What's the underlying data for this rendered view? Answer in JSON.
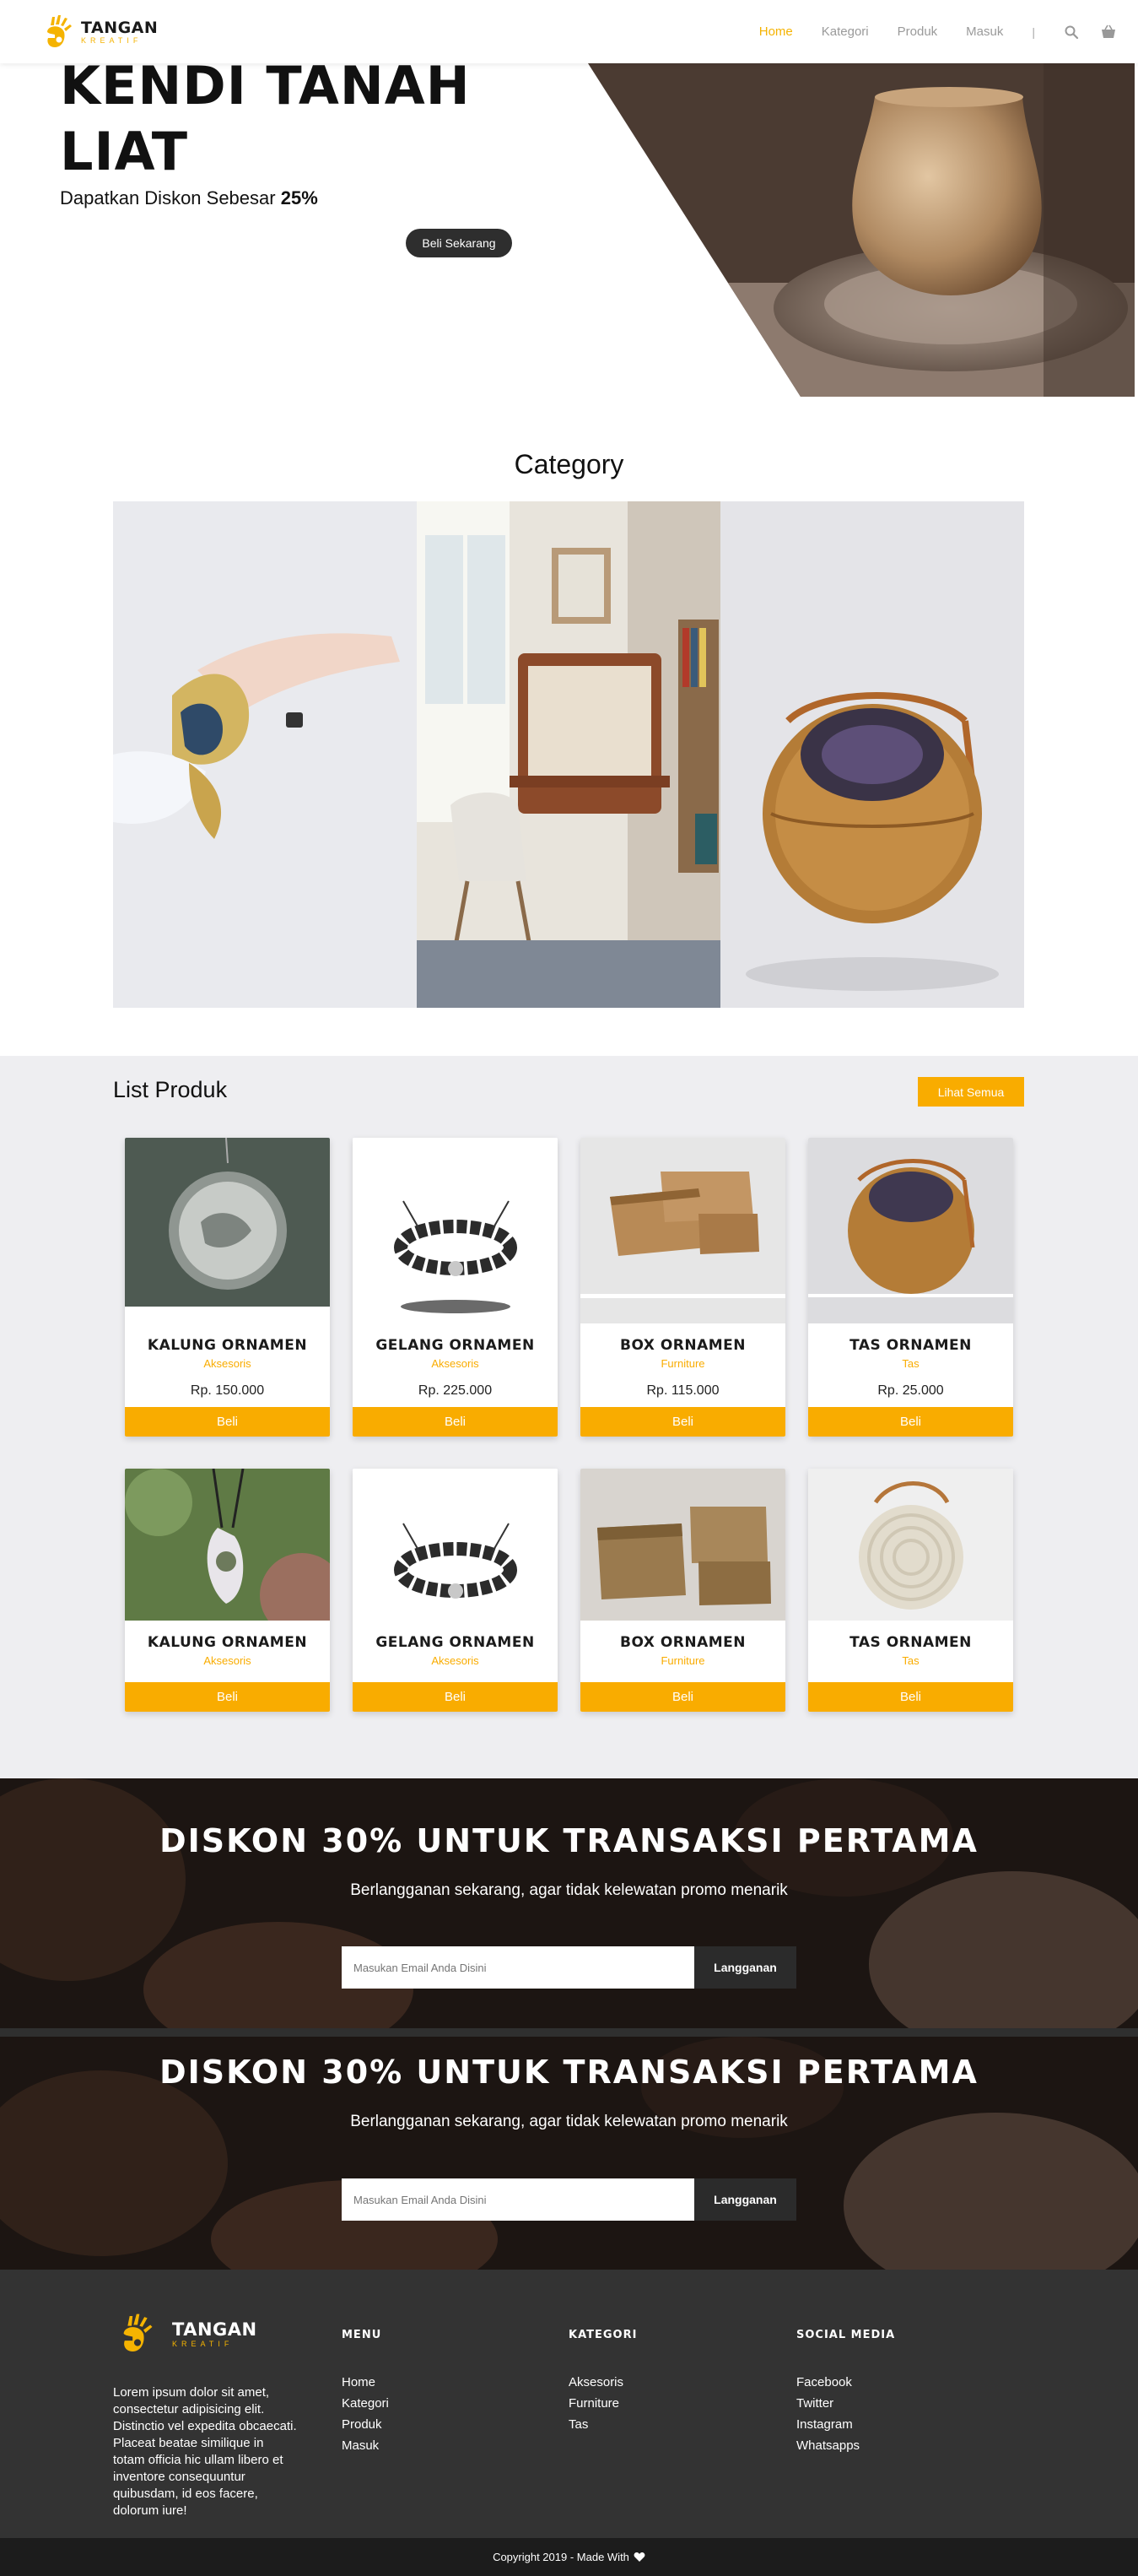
{
  "brand": {
    "name": "TANGAN",
    "tagline": "KREATIF"
  },
  "nav": {
    "items": [
      "Home",
      "Kategori",
      "Produk",
      "Masuk"
    ],
    "separator": "|",
    "icons": [
      "search-icon",
      "basket-icon"
    ]
  },
  "hero": {
    "title_line1": "KENDI TANAH",
    "title_line2": "LIAT",
    "subtitle_prefix": "Dapatkan Diskon Sebesar",
    "subtitle_value": "25%",
    "button": "Beli Sekarang"
  },
  "category": {
    "title": "Category"
  },
  "products": {
    "heading": "List Produk",
    "see_all": "Lihat Semua",
    "row1": [
      {
        "name": "KALUNG ORNAMEN",
        "category": "Aksesoris",
        "price": "Rp. 150.000",
        "button": "Beli"
      },
      {
        "name": "GELANG ORNAMEN",
        "category": "Aksesoris",
        "price": "Rp. 225.000",
        "button": "Beli"
      },
      {
        "name": "BOX ORNAMEN",
        "category": "Furniture",
        "price": "Rp. 115.000",
        "button": "Beli"
      },
      {
        "name": "TAS ORNAMEN",
        "category": "Tas",
        "price": "Rp. 25.000",
        "button": "Beli"
      }
    ],
    "row2": [
      {
        "name": "KALUNG ORNAMEN",
        "category": "Aksesoris",
        "button": "Beli"
      },
      {
        "name": "GELANG ORNAMEN",
        "category": "Aksesoris",
        "button": "Beli"
      },
      {
        "name": "BOX ORNAMEN",
        "category": "Furniture",
        "button": "Beli"
      },
      {
        "name": "TAS ORNAMEN",
        "category": "Tas",
        "button": "Beli"
      }
    ]
  },
  "newsletter": {
    "title": "DISKON 30% UNTUK TRANSAKSI PERTAMA",
    "subtitle": "Berlangganan sekarang, agar tidak kelewatan promo menarik",
    "placeholder": "Masukan Email Anda Disini",
    "button": "Langganan"
  },
  "footer": {
    "description": "Lorem ipsum dolor sit amet, consectetur adipisicing elit. Distinctio vel expedita obcaecati. Placeat beatae similique in totam officia hic ullam libero et inventore consequuntur quibusdam, id eos facere, dolorum iure!",
    "menu": {
      "title": "MENU",
      "items": [
        "Home",
        "Kategori",
        "Produk",
        "Masuk"
      ]
    },
    "kategori": {
      "title": "KATEGORI",
      "items": [
        "Aksesoris",
        "Furniture",
        "Tas"
      ]
    },
    "social": {
      "title": "SOCIAL MEDIA",
      "items": [
        "Facebook",
        "Twitter",
        "Instagram",
        "Whatsapps"
      ]
    },
    "copyright": "Copyright 2019 - Made With"
  },
  "colors": {
    "accent": "#f9ac00",
    "dark": "#333333",
    "section_bg": "#eeeef1"
  }
}
